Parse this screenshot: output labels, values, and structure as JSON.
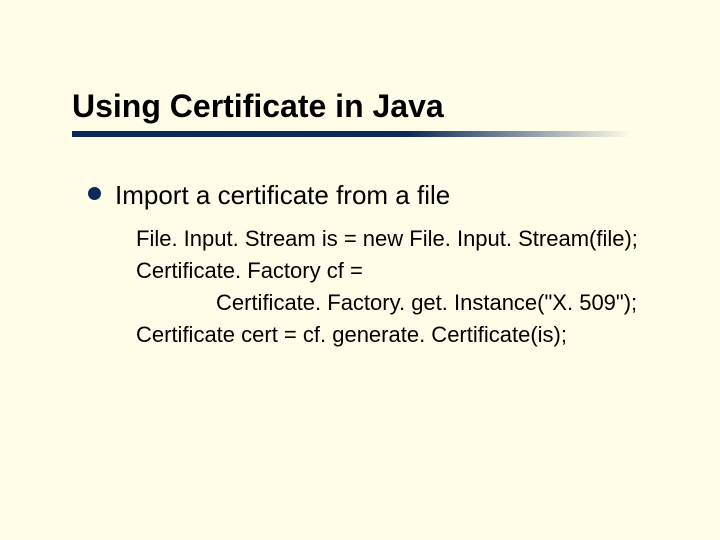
{
  "title": "Using Certificate in Java",
  "bullet": {
    "text": "Import a certificate from a file"
  },
  "code": {
    "l1": "File. Input. Stream is = new File. Input. Stream(file);",
    "l2": "Certificate. Factory cf =",
    "l3": "Certificate. Factory. get. Instance(\"X. 509\");",
    "l4": "Certificate cert = cf. generate. Certificate(is);"
  }
}
